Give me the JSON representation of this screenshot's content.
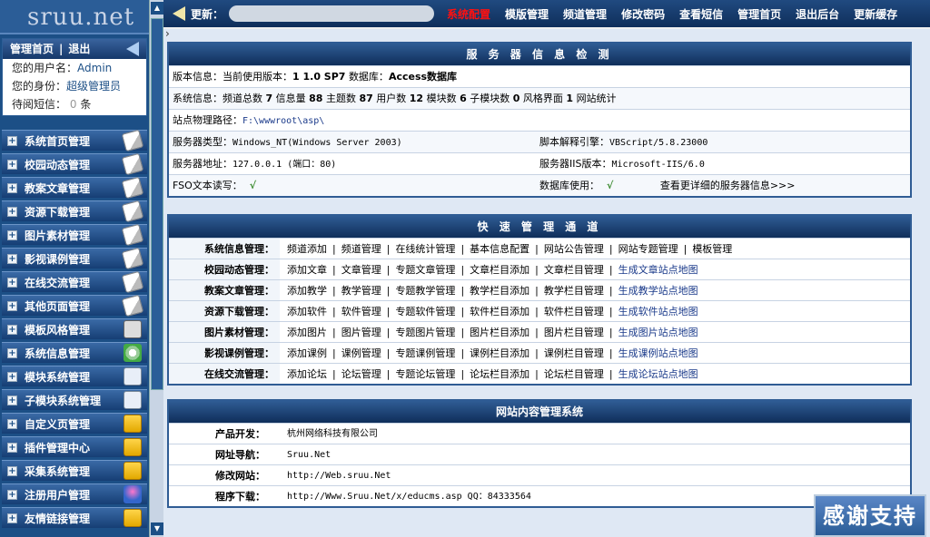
{
  "logo": "sruu.net",
  "sidebar": {
    "home_link": "管理首页",
    "logout_link": "退出",
    "user_label": "您的用户名：",
    "user_value": "Admin",
    "role_label": "您的身份：",
    "role_value": "超级管理员",
    "pending_label": "待阅短信：",
    "pending_count": "0",
    "pending_unit": "条",
    "menu": [
      {
        "label": "系统首页管理",
        "icon": "doc-icon"
      },
      {
        "label": "校园动态管理",
        "icon": "doc-icon"
      },
      {
        "label": "教案文章管理",
        "icon": "doc-icon"
      },
      {
        "label": "资源下载管理",
        "icon": "doc-icon"
      },
      {
        "label": "图片素材管理",
        "icon": "doc-icon"
      },
      {
        "label": "影视课例管理",
        "icon": "doc-icon"
      },
      {
        "label": "在线交流管理",
        "icon": "doc-icon"
      },
      {
        "label": "其他页面管理",
        "icon": "doc-icon"
      },
      {
        "label": "模板风格管理",
        "icon": "window-icon"
      },
      {
        "label": "系统信息管理",
        "icon": "gear-icon"
      },
      {
        "label": "模块系统管理",
        "icon": "page-icon"
      },
      {
        "label": "子模块系统管理",
        "icon": "page-icon"
      },
      {
        "label": "自定义页管理",
        "icon": "folder-icon"
      },
      {
        "label": "插件管理中心",
        "icon": "folder-icon"
      },
      {
        "label": "采集系统管理",
        "icon": "folder-icon"
      },
      {
        "label": "注册用户管理",
        "icon": "user-icon"
      },
      {
        "label": "友情链接管理",
        "icon": "folder-icon"
      }
    ]
  },
  "topbar": {
    "update_label": "更新：",
    "nav": [
      "系统配置",
      "模版管理",
      "频道管理",
      "修改密码",
      "查看短信",
      "管理首页",
      "退出后台",
      "更新缓存"
    ],
    "active_index": 0
  },
  "server_panel": {
    "title": "服 务 器 信 息 检 测",
    "version_label": "版本信息：当前使用版本：",
    "version_value": "1 1.0 SP7",
    "db_label": "数据库：",
    "db_value": "Access数据库",
    "system_label": "系统信息：",
    "stats": [
      {
        "label": "频道总数",
        "value": "7"
      },
      {
        "label": "信息量",
        "value": "88"
      },
      {
        "label": "主题数",
        "value": "87"
      },
      {
        "label": "用户数",
        "value": "12"
      },
      {
        "label": "模块数",
        "value": "6"
      },
      {
        "label": "子模块数",
        "value": "0"
      },
      {
        "label": "风格界面",
        "value": "1"
      }
    ],
    "stats_suffix": "网站统计",
    "path_label": "站点物理路径：",
    "path_value": "F:\\wwwroot\\asp\\",
    "server_type_label": "服务器类型：",
    "server_type_value": "Windows_NT(Windows Server 2003)",
    "script_engine_label": "脚本解释引擎：",
    "script_engine_value": "VBScript/5.8.23000",
    "address_label": "服务器地址：",
    "address_value": "127.0.0.1 (端口：80)",
    "iis_label": "服务器IIS版本：",
    "iis_value": "Microsoft-IIS/6.0",
    "fso_label": "FSO文本读写：",
    "fso_value": "√",
    "db_use_label": "数据库使用：",
    "db_use_value": "√",
    "more_link": "查看更详细的服务器信息>>>"
  },
  "quick_panel": {
    "title": "快 速 管 理 通 道",
    "rows": [
      {
        "label": "系统信息管理：",
        "links": [
          "频道添加",
          "频道管理",
          "在线统计管理",
          "基本信息配置",
          "网站公告管理",
          "网站专题管理",
          "模板管理"
        ],
        "blue": ""
      },
      {
        "label": "校园动态管理：",
        "links": [
          "添加文章",
          "文章管理",
          "专题文章管理",
          "文章栏目添加",
          "文章栏目管理"
        ],
        "blue": "生成文章站点地图"
      },
      {
        "label": "教案文章管理：",
        "links": [
          "添加教学",
          "教学管理",
          "专题教学管理",
          "教学栏目添加",
          "教学栏目管理"
        ],
        "blue": "生成教学站点地图"
      },
      {
        "label": "资源下载管理：",
        "links": [
          "添加软件",
          "软件管理",
          "专题软件管理",
          "软件栏目添加",
          "软件栏目管理"
        ],
        "blue": "生成软件站点地图"
      },
      {
        "label": "图片素材管理：",
        "links": [
          "添加图片",
          "图片管理",
          "专题图片管理",
          "图片栏目添加",
          "图片栏目管理"
        ],
        "blue": "生成图片站点地图"
      },
      {
        "label": "影视课例管理：",
        "links": [
          "添加课例",
          "课例管理",
          "专题课例管理",
          "课例栏目添加",
          "课例栏目管理"
        ],
        "blue": "生成课例站点地图"
      },
      {
        "label": "在线交流管理：",
        "links": [
          "添加论坛",
          "论坛管理",
          "专题论坛管理",
          "论坛栏目添加",
          "论坛栏目管理"
        ],
        "blue": "生成论坛站点地图"
      }
    ]
  },
  "info_panel": {
    "title": "网站内容管理系统",
    "rows": [
      {
        "label": "产品开发：",
        "value": "杭州网络科技有限公司"
      },
      {
        "label": "网址导航：",
        "value": "Sruu.Net"
      },
      {
        "label": "修改网站：",
        "value": "http://Web.sruu.Net"
      },
      {
        "label": "程序下载：",
        "value": "http://Www.Sruu.Net/x/educms.asp QQ：84333564"
      }
    ]
  },
  "thanks_button": "感谢支持"
}
